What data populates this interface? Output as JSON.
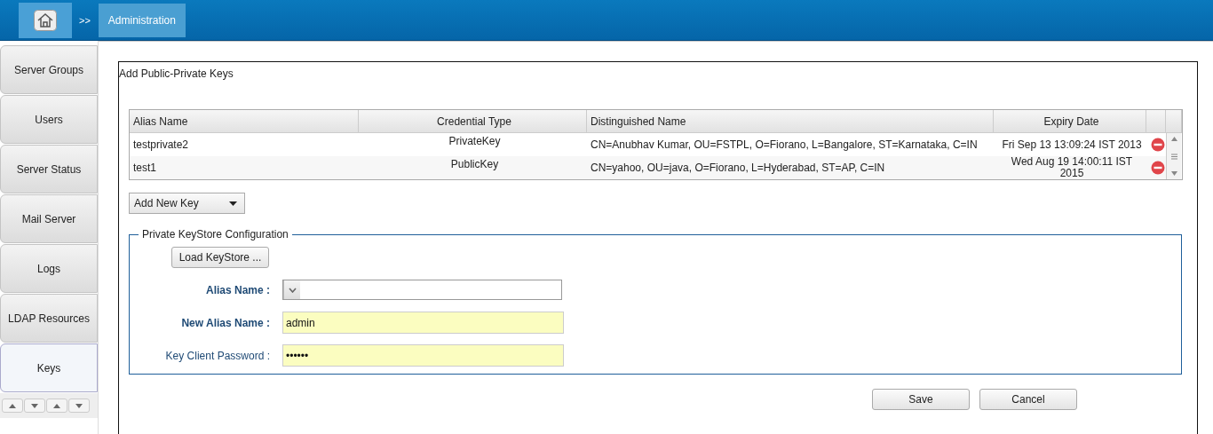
{
  "breadcrumb": {
    "separator": ">>",
    "current": "Administration"
  },
  "sidebar": {
    "items": [
      {
        "label": "Server Groups",
        "selected": false
      },
      {
        "label": "Users",
        "selected": false
      },
      {
        "label": "Server Status",
        "selected": false
      },
      {
        "label": "Mail Server",
        "selected": false
      },
      {
        "label": "Logs",
        "selected": false
      },
      {
        "label": "LDAP Resources",
        "selected": false
      },
      {
        "label": "Keys",
        "selected": true
      }
    ]
  },
  "panel": {
    "title": "Add Public-Private Keys",
    "table": {
      "columns": [
        "Alias Name",
        "Credential Type",
        "Distinguished Name",
        "Expiry Date"
      ],
      "rows": [
        {
          "alias": "testprivate2",
          "type": "PrivateKey",
          "dn": "CN=Anubhav Kumar, OU=FSTPL, O=Fiorano, L=Bangalore, ST=Karnataka, C=IN",
          "expiry": "Fri Sep 13 13:09:24 IST 2013"
        },
        {
          "alias": "test1",
          "type": "PublicKey",
          "dn": "CN=yahoo, OU=java, O=Fiorano, L=Hyderabad, ST=AP, C=IN",
          "expiry": "Wed Aug 19 14:00:11 IST 2015"
        }
      ]
    },
    "add_menu": "Add New Key",
    "keystore": {
      "legend": "Private KeyStore Configuration",
      "load_button": "Load KeyStore ...",
      "fields": [
        {
          "label": "Alias Name :",
          "kind": "dropdown",
          "bold": true
        },
        {
          "label": "New Alias Name :",
          "kind": "text",
          "bold": true,
          "value": "admin"
        },
        {
          "label": "Key Client Password :",
          "kind": "text",
          "bold": false,
          "value": "••••••"
        }
      ]
    },
    "buttons": [
      "Save",
      "Cancel"
    ]
  }
}
